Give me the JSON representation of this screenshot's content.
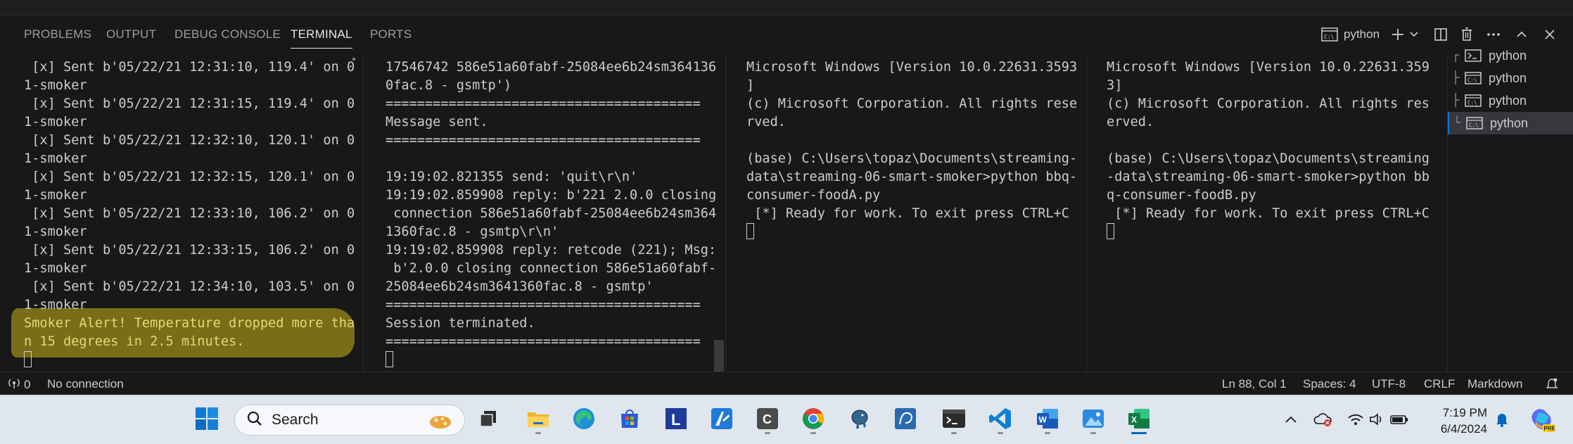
{
  "panel": {
    "tabs": [
      {
        "label": "PROBLEMS"
      },
      {
        "label": "OUTPUT"
      },
      {
        "label": "DEBUG CONSOLE"
      },
      {
        "label": "TERMINAL"
      },
      {
        "label": "PORTS"
      }
    ],
    "active_tab": "TERMINAL",
    "terminal_label": "python",
    "actions": [
      "new-terminal",
      "launch-profile",
      "split-terminal",
      "kill-terminal",
      "more-actions",
      "maximize-panel",
      "close-panel"
    ]
  },
  "terminals": [
    {
      "lines": [
        " [x] Sent b'05/22/21 12:31:10, 119.4' on 0",
        "1-smoker",
        " [x] Sent b'05/22/21 12:31:15, 119.4' on 0",
        "1-smoker",
        " [x] Sent b'05/22/21 12:32:10, 120.1' on 0",
        "1-smoker",
        " [x] Sent b'05/22/21 12:32:15, 120.1' on 0",
        "1-smoker",
        " [x] Sent b'05/22/21 12:33:10, 106.2' on 0",
        "1-smoker",
        " [x] Sent b'05/22/21 12:33:15, 106.2' on 0",
        "1-smoker",
        " [x] Sent b'05/22/21 12:34:10, 103.5' on 0",
        "1-smoker"
      ],
      "alert_lines": [
        "Smoker Alert! Temperature dropped more tha",
        "n 15 degrees in 2.5 minutes."
      ]
    },
    {
      "lines": [
        "17546742 586e51a60fabf-25084ee6b24sm364136",
        "0fac.8 - gsmtp')",
        "========================================",
        "Message sent.",
        "========================================",
        "",
        "19:19:02.821355 send: 'quit\\r\\n'",
        "19:19:02.859908 reply: b'221 2.0.0 closing",
        " connection 586e51a60fabf-25084ee6b24sm364",
        "1360fac.8 - gsmtp\\r\\n'",
        "19:19:02.859908 reply: retcode (221); Msg:",
        " b'2.0.0 closing connection 586e51a60fabf-",
        "25084ee6b24sm3641360fac.8 - gsmtp'",
        "========================================",
        "Session terminated.",
        "========================================"
      ]
    },
    {
      "lines": [
        "Microsoft Windows [Version 10.0.22631.3593",
        "]",
        "(c) Microsoft Corporation. All rights rese",
        "rved.",
        "",
        "(base) C:\\Users\\topaz\\Documents\\streaming-",
        "data\\streaming-06-smart-smoker>python bbq-",
        "consumer-foodA.py",
        " [*] Ready for work. To exit press CTRL+C"
      ]
    },
    {
      "lines": [
        "Microsoft Windows [Version 10.0.22631.359",
        "3]",
        "(c) Microsoft Corporation. All rights res",
        "erved.",
        "",
        "(base) C:\\Users\\topaz\\Documents\\streaming",
        "-data\\streaming-06-smart-smoker>python bb",
        "q-consumer-foodB.py",
        " [*] Ready for work. To exit press CTRL+C"
      ]
    }
  ],
  "terminal_list": [
    {
      "label": "python",
      "icon": "powershell-icon"
    },
    {
      "label": "python",
      "icon": "cmd-icon"
    },
    {
      "label": "python",
      "icon": "cmd-icon"
    },
    {
      "label": "python",
      "icon": "cmd-icon"
    }
  ],
  "status": {
    "ports": "0",
    "connection": "No connection",
    "position": "Ln 88, Col 1",
    "spaces": "Spaces: 4",
    "encoding": "UTF-8",
    "eol": "CRLF",
    "language": "Markdown"
  },
  "taskbar": {
    "search_label": "Search",
    "apps": [
      "start",
      "file-explorer",
      "edge",
      "microsoft-store",
      "l-app",
      "pen-app",
      "c-app",
      "chrome",
      "postgresql",
      "pgadmin",
      "windows-terminal",
      "vscode",
      "word",
      "photos",
      "excel"
    ],
    "time": "7:19 PM",
    "date": "6/4/2024",
    "colors": {
      "accent": "#0067c0",
      "excel": "#107c41",
      "word": "#185abc",
      "vscode": "#0e7fd6"
    }
  },
  "colors": {
    "alert_highlight": "#7a6d18",
    "alert_text": "#e8d77a",
    "panel_bg": "#181818"
  }
}
